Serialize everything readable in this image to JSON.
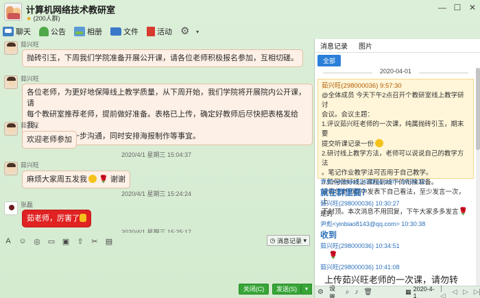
{
  "window": {
    "title": "计算机网络技术教研室",
    "member_count": "(200人群)",
    "star": "★"
  },
  "toolbar": {
    "items": [
      {
        "label": "聊天"
      },
      {
        "label": "公告"
      },
      {
        "label": "相册"
      },
      {
        "label": "文件"
      },
      {
        "label": "活动"
      }
    ]
  },
  "chat": {
    "messages": [
      {
        "sender": "茹兴旺",
        "text": "抛砖引玉，下周我们学院准备开展公开课，请各位老师积极报名参加，互相切磋。"
      },
      {
        "sender": "茹兴旺",
        "lines": [
          "各位老师，为更好地保障线上教学质量，从下周开始，我们学院将开展院内公开课，请",
          "每个教研室推荐老师，提前做好准备。表格已上传，确定好教师后尽快把表格发给我，",
          "我们会进行下一步沟通，同时安排海报制作等事宜。"
        ]
      },
      {
        "sender": "茹兴旺",
        "text": "欢迎老师参加"
      },
      {
        "time": "2020/4/1 星期三 15:04:37"
      },
      {
        "sender": "茹兴旺",
        "text": "麻烦大家周五发我",
        "suffix": "谢谢"
      },
      {
        "time": "2020/4/1 星期三 15:24:24"
      },
      {
        "sender": "张磊",
        "text": "茹老师，厉害了"
      },
      {
        "time": "2020/4/1 星期三 15:25:17"
      }
    ]
  },
  "composer": {
    "history_label": "消息记录",
    "close_label": "关闭(C)",
    "send_label": "发送(S)"
  },
  "panel": {
    "tab_history": "消息记录",
    "tab_pictures": "图片",
    "filter_all": "全部",
    "date": "2020-04-01",
    "notice": {
      "header": "茹兴旺(298000036) 9:57:30",
      "lines": [
        "@全体成员 今天下午2点召开个教研室线上教学研讨",
        "会议。会议主题：",
        "1.评议茹兴旺老师的一次课，纯属抛砖引玉，期末要",
        "提交听课记录一份",
        "2.研讨线上教学方法，老师可以说说自己的教学方法",
        "。笔记作业教学法可否用于自己教学。",
        "3.如何做好线上课程到线下的衔接准备。",
        "请每位老师群中发表下自己看法，至少发言一次，上",
        "不封顶。本次消息不用回复，下午大家多多发言"
      ]
    },
    "entries": [
      {
        "meta": "尹彪<yinbiao8143@qq.com> 10:29:12"
      },
      {
        "big": "就在群里面？"
      },
      {
        "meta": "茹兴旺(298000036) 10:30:27"
      },
      {
        "text": "是的"
      },
      {
        "meta": "尹彪<yinbiao8143@qq.com> 10:30:38"
      },
      {
        "big": "收到"
      },
      {
        "meta": "茹兴旺(298000036) 10:34:51"
      },
      {
        "meta": "茹兴旺(298000036) 10:41:08"
      },
      {
        "large": "上传茹兴旺老师的一次课，请勿转"
      }
    ],
    "footer": {
      "settings_label": "设置",
      "date": "2020-4-1"
    }
  }
}
